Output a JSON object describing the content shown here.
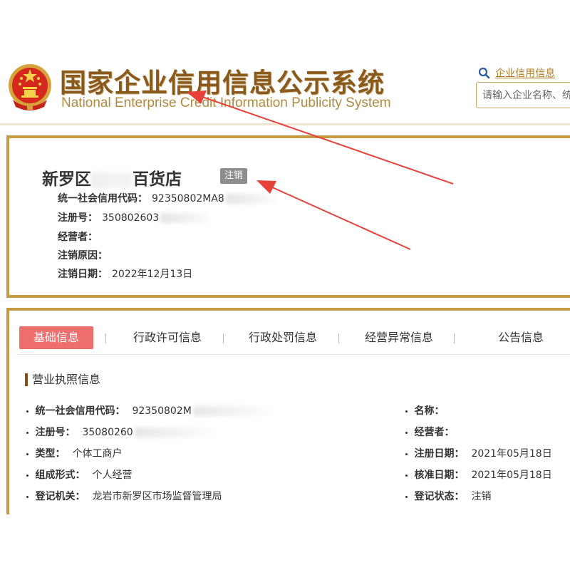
{
  "header": {
    "title_cn": "国家企业信用信息公示系统",
    "title_en": "National Enterprise Credit Information Publicity System",
    "search_link": "企业信用信息",
    "search_placeholder": "请输入企业名称、统"
  },
  "company": {
    "name_prefix": "新罗区",
    "name_suffix": "百货店",
    "status_tag": "注销",
    "fields": [
      {
        "label": "统一社会信用代码：",
        "value": "92350802MA8"
      },
      {
        "label": "注册号：",
        "value": "350802603"
      },
      {
        "label": "经营者：",
        "value": ""
      },
      {
        "label": "注销原因：",
        "value": ""
      },
      {
        "label": "注销日期：",
        "value": "2022年12月13日"
      }
    ]
  },
  "tabs": [
    {
      "label": "基础信息",
      "active": true
    },
    {
      "label": "行政许可信息",
      "active": false
    },
    {
      "label": "行政处罚信息",
      "active": false
    },
    {
      "label": "经营异常信息",
      "active": false
    },
    {
      "label": "公告信息",
      "active": false
    }
  ],
  "license": {
    "section_title": "营业执照信息",
    "left": [
      {
        "label": "统一社会信用代码：",
        "value": "92350802M"
      },
      {
        "label": "注册号：",
        "value": "35080260"
      },
      {
        "label": "类型：",
        "value": "个体工商户"
      },
      {
        "label": "组成形式：",
        "value": "个人经营"
      },
      {
        "label": "登记机关：",
        "value": "龙岩市新罗区市场监督管理局"
      }
    ],
    "right": [
      {
        "label": "名称：",
        "value": ""
      },
      {
        "label": "经营者：",
        "value": ""
      },
      {
        "label": "注册日期：",
        "value": "2021年05月18日"
      },
      {
        "label": "核准日期：",
        "value": "2021年05月18日"
      },
      {
        "label": "登记状态：",
        "value": "注销"
      }
    ]
  },
  "colors": {
    "brand_gold": "#c49a45",
    "title_brown": "#8a5a1c",
    "active_tab": "#ef6e6e",
    "status_gray": "#8d8d8d",
    "annotation_red": "#e8413a"
  }
}
